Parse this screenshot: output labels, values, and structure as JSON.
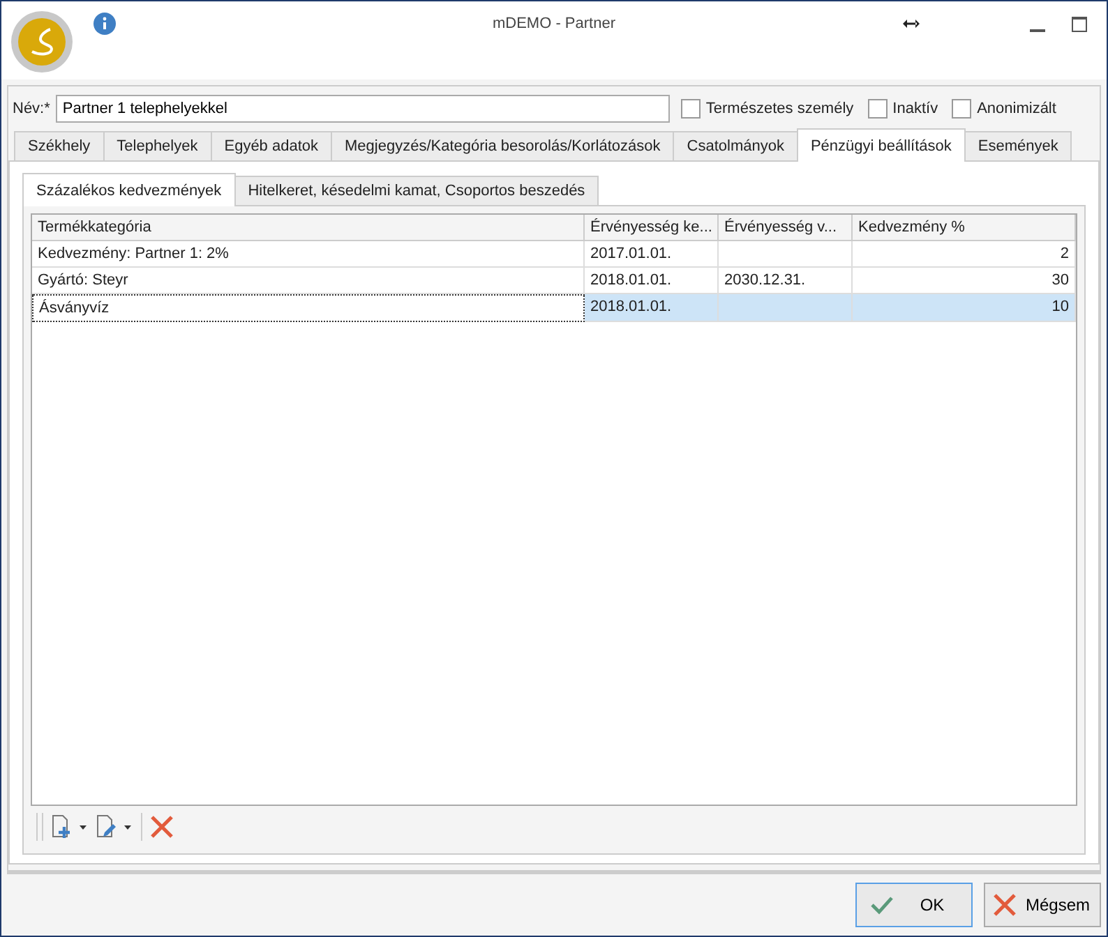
{
  "window": {
    "title": "mDEMO - Partner"
  },
  "name_field": {
    "label": "Név:*",
    "value": "Partner 1 telephelyekkel"
  },
  "checkboxes": [
    {
      "label": "Természetes személy",
      "checked": false
    },
    {
      "label": "Inaktív",
      "checked": false
    },
    {
      "label": "Anonimizált",
      "checked": false
    }
  ],
  "tabs": [
    {
      "label": "Székhely",
      "selected": false
    },
    {
      "label": "Telephelyek",
      "selected": false
    },
    {
      "label": "Egyéb adatok",
      "selected": false
    },
    {
      "label": "Megjegyzés/Kategória besorolás/Korlátozások",
      "selected": false
    },
    {
      "label": "Csatolmányok",
      "selected": false
    },
    {
      "label": "Pénzügyi beállítások",
      "selected": true
    },
    {
      "label": "Események",
      "selected": false
    }
  ],
  "subtabs": [
    {
      "label": "Százalékos kedvezmények",
      "selected": true
    },
    {
      "label": "Hitelkeret, késedelmi kamat, Csoportos beszedés",
      "selected": false
    }
  ],
  "table": {
    "columns": [
      "Termékkategória",
      "Érvényesség ke...",
      "Érvényesség v...",
      "Kedvezmény %"
    ],
    "rows": [
      {
        "cells": [
          "Kedvezmény: Partner 1: 2%",
          "2017.01.01.",
          "",
          "2"
        ],
        "selected": false
      },
      {
        "cells": [
          "Gyártó: Steyr",
          "2018.01.01.",
          "2030.12.31.",
          "30"
        ],
        "selected": false
      },
      {
        "cells": [
          "Ásványvíz",
          "2018.01.01.",
          "",
          "10"
        ],
        "selected": true
      }
    ]
  },
  "buttons": [
    {
      "label": "OK",
      "kind": "ok"
    },
    {
      "label": "Mégsem",
      "kind": "cancel"
    }
  ]
}
